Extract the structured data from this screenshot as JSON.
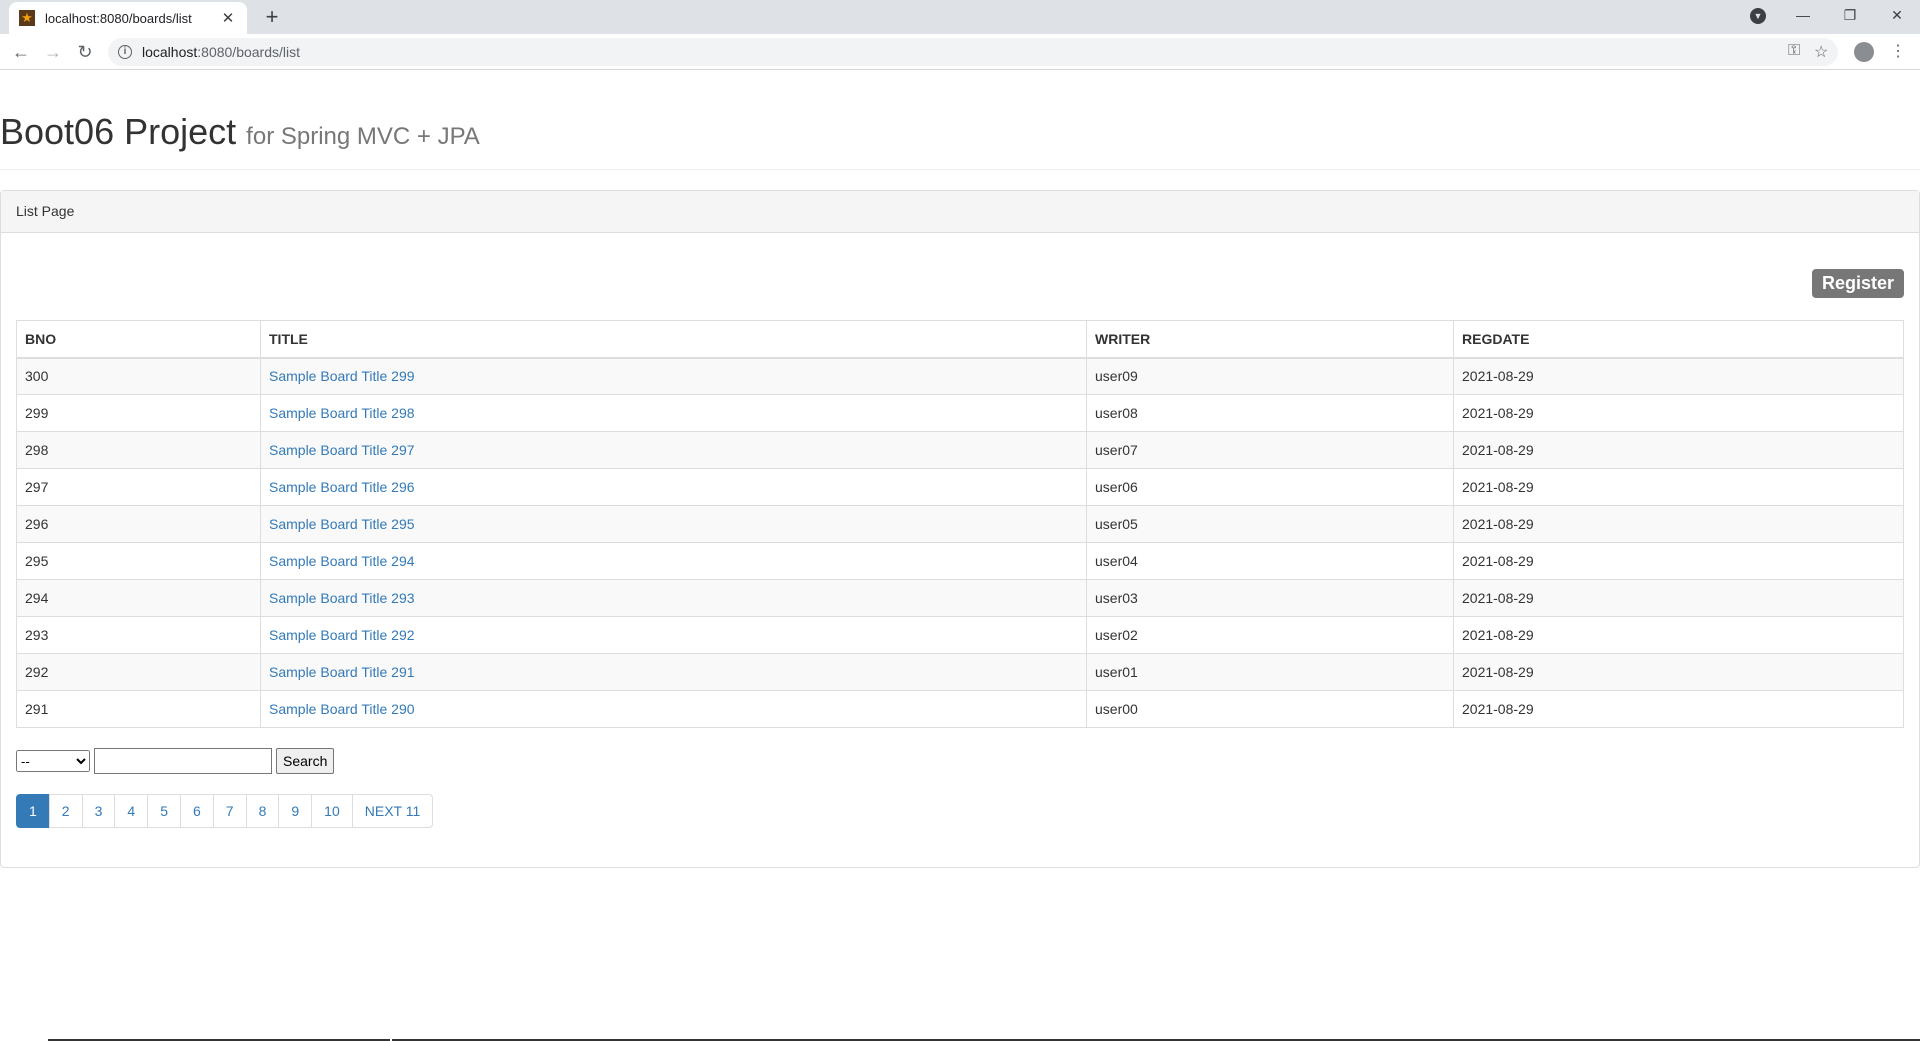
{
  "browser": {
    "tab_title": "localhost:8080/boards/list",
    "url_host": "localhost",
    "url_rest": ":8080/boards/list",
    "close_glyph": "✕",
    "newtab_glyph": "+"
  },
  "page": {
    "title": "Boot06 Project",
    "subtitle": "for Spring MVC + JPA",
    "panel_heading": "List Page",
    "register_label": "Register",
    "columns": [
      "BNO",
      "TITLE",
      "WRITER",
      "REGDATE"
    ],
    "rows": [
      {
        "bno": "300",
        "title": "Sample Board Title 299",
        "writer": "user09",
        "regdate": "2021-08-29"
      },
      {
        "bno": "299",
        "title": "Sample Board Title 298",
        "writer": "user08",
        "regdate": "2021-08-29"
      },
      {
        "bno": "298",
        "title": "Sample Board Title 297",
        "writer": "user07",
        "regdate": "2021-08-29"
      },
      {
        "bno": "297",
        "title": "Sample Board Title 296",
        "writer": "user06",
        "regdate": "2021-08-29"
      },
      {
        "bno": "296",
        "title": "Sample Board Title 295",
        "writer": "user05",
        "regdate": "2021-08-29"
      },
      {
        "bno": "295",
        "title": "Sample Board Title 294",
        "writer": "user04",
        "regdate": "2021-08-29"
      },
      {
        "bno": "294",
        "title": "Sample Board Title 293",
        "writer": "user03",
        "regdate": "2021-08-29"
      },
      {
        "bno": "293",
        "title": "Sample Board Title 292",
        "writer": "user02",
        "regdate": "2021-08-29"
      },
      {
        "bno": "292",
        "title": "Sample Board Title 291",
        "writer": "user01",
        "regdate": "2021-08-29"
      },
      {
        "bno": "291",
        "title": "Sample Board Title 290",
        "writer": "user00",
        "regdate": "2021-08-29"
      }
    ],
    "search": {
      "select_value": "--",
      "input_value": "",
      "button_label": "Search"
    },
    "pagination": [
      "1",
      "2",
      "3",
      "4",
      "5",
      "6",
      "7",
      "8",
      "9",
      "10",
      "NEXT 11"
    ],
    "active_page": "1",
    "colors": {
      "link": "#337ab7",
      "register_bg": "#777777"
    }
  }
}
